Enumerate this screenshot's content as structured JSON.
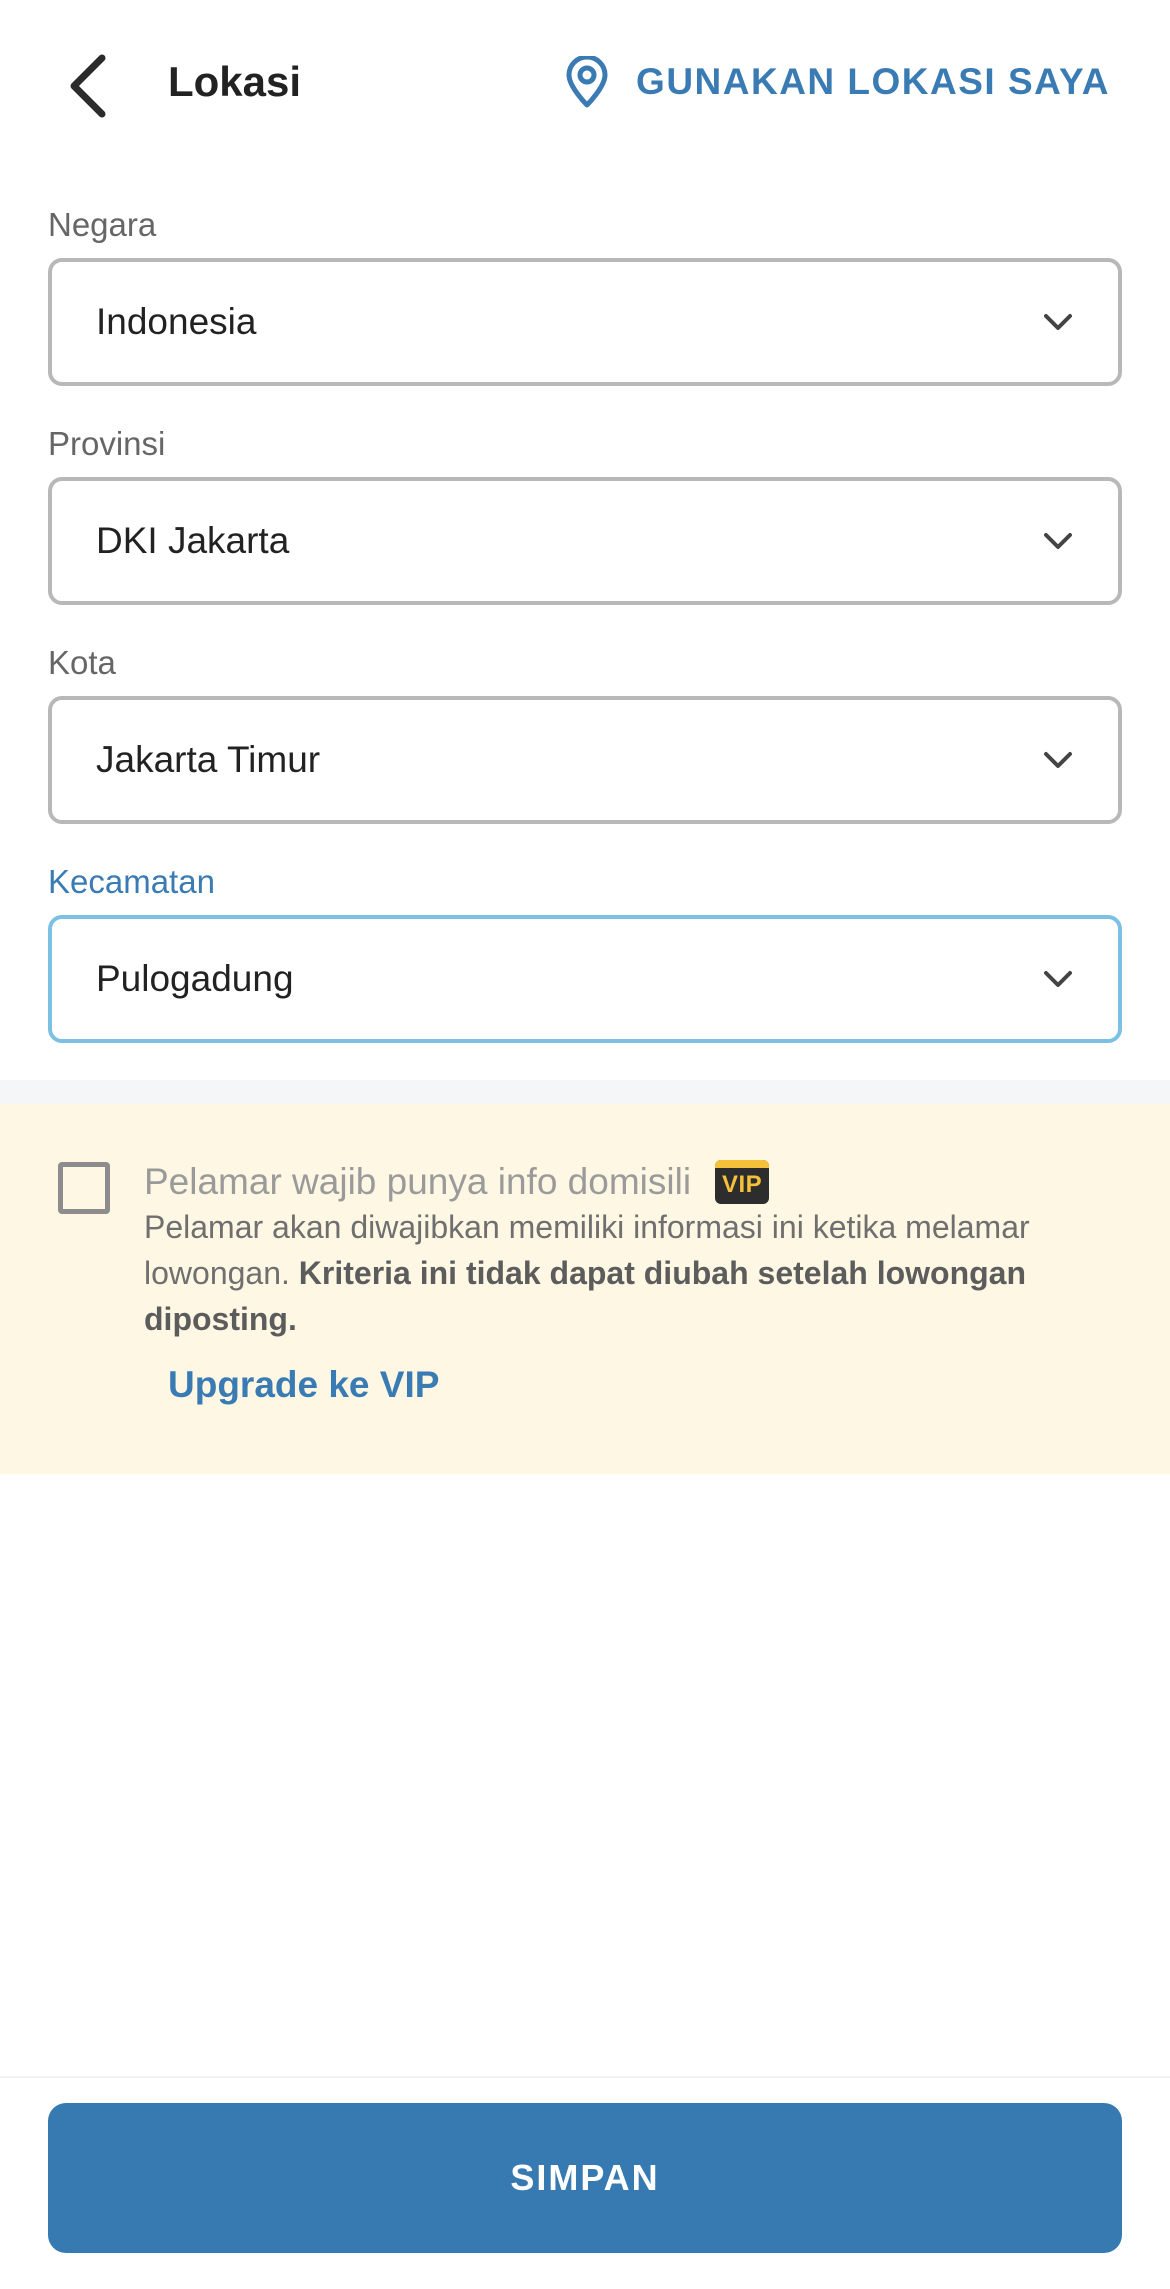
{
  "header": {
    "title": "Lokasi",
    "use_location_label": "GUNAKAN LOKASI SAYA"
  },
  "form": {
    "fields": [
      {
        "label": "Negara",
        "value": "Indonesia",
        "focused": false
      },
      {
        "label": "Provinsi",
        "value": "DKI Jakarta",
        "focused": false
      },
      {
        "label": "Kota",
        "value": "Jakarta Timur",
        "focused": false
      },
      {
        "label": "Kecamatan",
        "value": "Pulogadung",
        "focused": true
      }
    ]
  },
  "vip": {
    "checkbox_checked": false,
    "title": "Pelamar wajib punya info domisili",
    "badge": "VIP",
    "desc_normal": "Pelamar akan diwajibkan memiliki informasi ini ketika melamar lowongan.",
    "desc_bold": "Kriteria ini tidak dapat diubah setelah lowongan diposting.",
    "upgrade_label": "Upgrade ke VIP"
  },
  "footer": {
    "save_label": "SIMPAN"
  },
  "colors": {
    "accent": "#3a7bb4",
    "button": "#377ab2",
    "vip_bg": "#fdf7e4",
    "focus_border": "#7cc0e3",
    "vip_badge_bg": "#2d2d2d",
    "vip_badge_text": "#f5c03a"
  },
  "icons": {
    "back": "chevron-left-icon",
    "location": "location-pin-icon",
    "dropdown": "chevron-down-icon"
  }
}
